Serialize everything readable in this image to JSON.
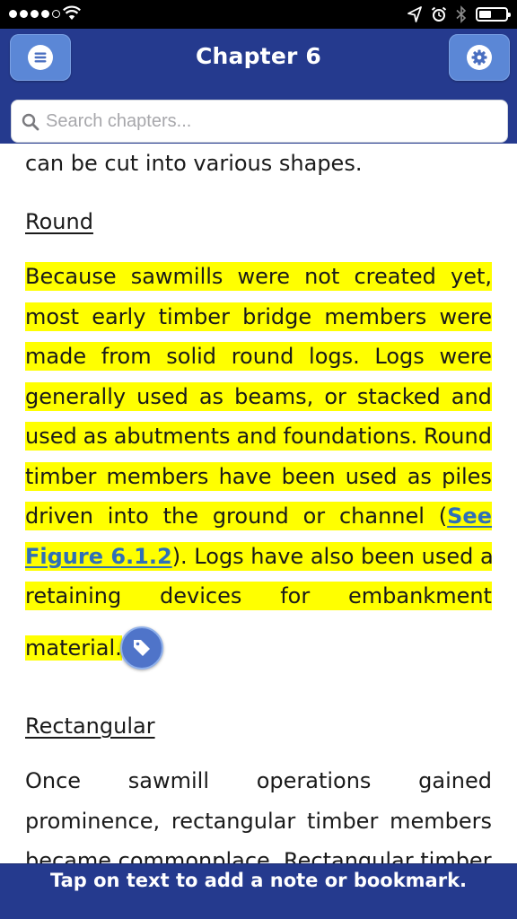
{
  "status_bar": {
    "signal_bars_filled": 4,
    "signal_bars_total": 5,
    "icons": [
      "wifi-icon",
      "location-arrow-icon",
      "alarm-clock-icon",
      "bluetooth-icon",
      "battery-icon"
    ],
    "battery_level": 0.45
  },
  "header": {
    "title": "Chapter 6",
    "menu_icon": "hamburger-menu-icon",
    "settings_icon": "gear-icon",
    "background": "#253a8e",
    "button_color": "#5b87d6"
  },
  "search": {
    "placeholder": "Search chapters...",
    "value": "",
    "icon": "search-icon"
  },
  "content": {
    "cut_line": "can be cut into various shapes.",
    "round": {
      "heading": "Round",
      "highlight_color": "#ffff00",
      "lines": [
        [
          "Because",
          "sawmills",
          "were",
          "not",
          "created",
          "yet,"
        ],
        [
          "most",
          "early",
          "timber",
          "bridge",
          "members",
          "were"
        ],
        [
          "made",
          "from",
          "solid",
          "round",
          "logs.",
          "Logs",
          "were"
        ],
        [
          "generally",
          "used",
          "as",
          "beams,",
          "or",
          "stacked",
          "and"
        ],
        [
          "used",
          "as",
          "abutments",
          "and",
          "foundations.",
          "Round"
        ],
        [
          "timber",
          "members",
          "have",
          "been",
          "used",
          "as",
          "piles"
        ],
        [
          "driven",
          "into",
          "the",
          "ground",
          "or",
          "channel",
          "("
        ],
        [
          "Figure 6.1.2",
          "). Logs have also been used as"
        ],
        [
          "retaining",
          "devices",
          "for",
          "embankment"
        ]
      ],
      "link_part1": "See",
      "last_line": "material.",
      "tag_icon": "tag-icon"
    },
    "rectangular": {
      "heading": "Rectangular",
      "lines": [
        [
          "Once",
          "sawmill",
          "operations",
          "gained"
        ],
        [
          "prominence,",
          "rectangular",
          "timber",
          "members"
        ],
        [
          "became commonplace. Rectangular timber"
        ]
      ]
    }
  },
  "bottom_bar": {
    "message": "Tap on text to add a note or bookmark."
  }
}
